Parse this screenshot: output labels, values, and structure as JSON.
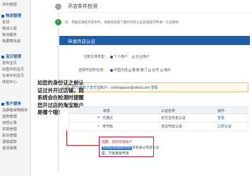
{
  "sidebar": {
    "top_item": "评价管理",
    "groups": [
      {
        "title": "物流管理",
        "items": [
          "发货",
          "物流工具",
          "物流服务",
          "我要寄快递"
        ]
      },
      {
        "title": "宝贝管理",
        "items": [
          "发布宝贝",
          "出售中的宝贝",
          "仓库中的宝贝",
          "体检中心"
        ]
      },
      {
        "title": "客户服务",
        "items": [
          "消费者保障服务",
          "退款管理",
          "违规记录",
          "举报管理",
          "投诉管理",
          "退税退款",
          "退货保障"
        ]
      }
    ]
  },
  "main": {
    "section1_title": "开店条件检测",
    "section1_note": "您：恭喜您满足开店条件，请继续完成下面的开店认证后再提交申请！认证帮助",
    "section2_title": "申请开店认证",
    "form": {
      "subject_label": "注册主体类型：",
      "subject_options": [
        "个人用户",
        "企业用户"
      ],
      "region_label": "选择开店所在地：",
      "region_options": [
        "中国大陆",
        "香港/澳门",
        "台湾",
        "海外"
      ],
      "auth_label": "认证：",
      "auth_text": "您已绑定了支付宝账户：andongquan@aliest.com 查看"
    },
    "table": {
      "headers": [
        "状态",
        "认证名称",
        "操作"
      ],
      "rows": [
        {
          "status": "已通过",
          "name": "支付宝实名认证",
          "action": "查看"
        },
        {
          "status": "未开始",
          "name": "淘宝开店认证",
          "action": "立即认证"
        }
      ]
    },
    "popup": {
      "line1": "提醒：您的淘宝账户",
      "account": "Taobaokaidianzhifu",
      "line2_tail": "没有通过淘宝认证",
      "line3": "是，不能重复申请"
    },
    "annotation": "如您的身份证之前认证过并开过店铺，则系统会在检测时提醒您开过店的淘宝账户是哪个哦！"
  }
}
